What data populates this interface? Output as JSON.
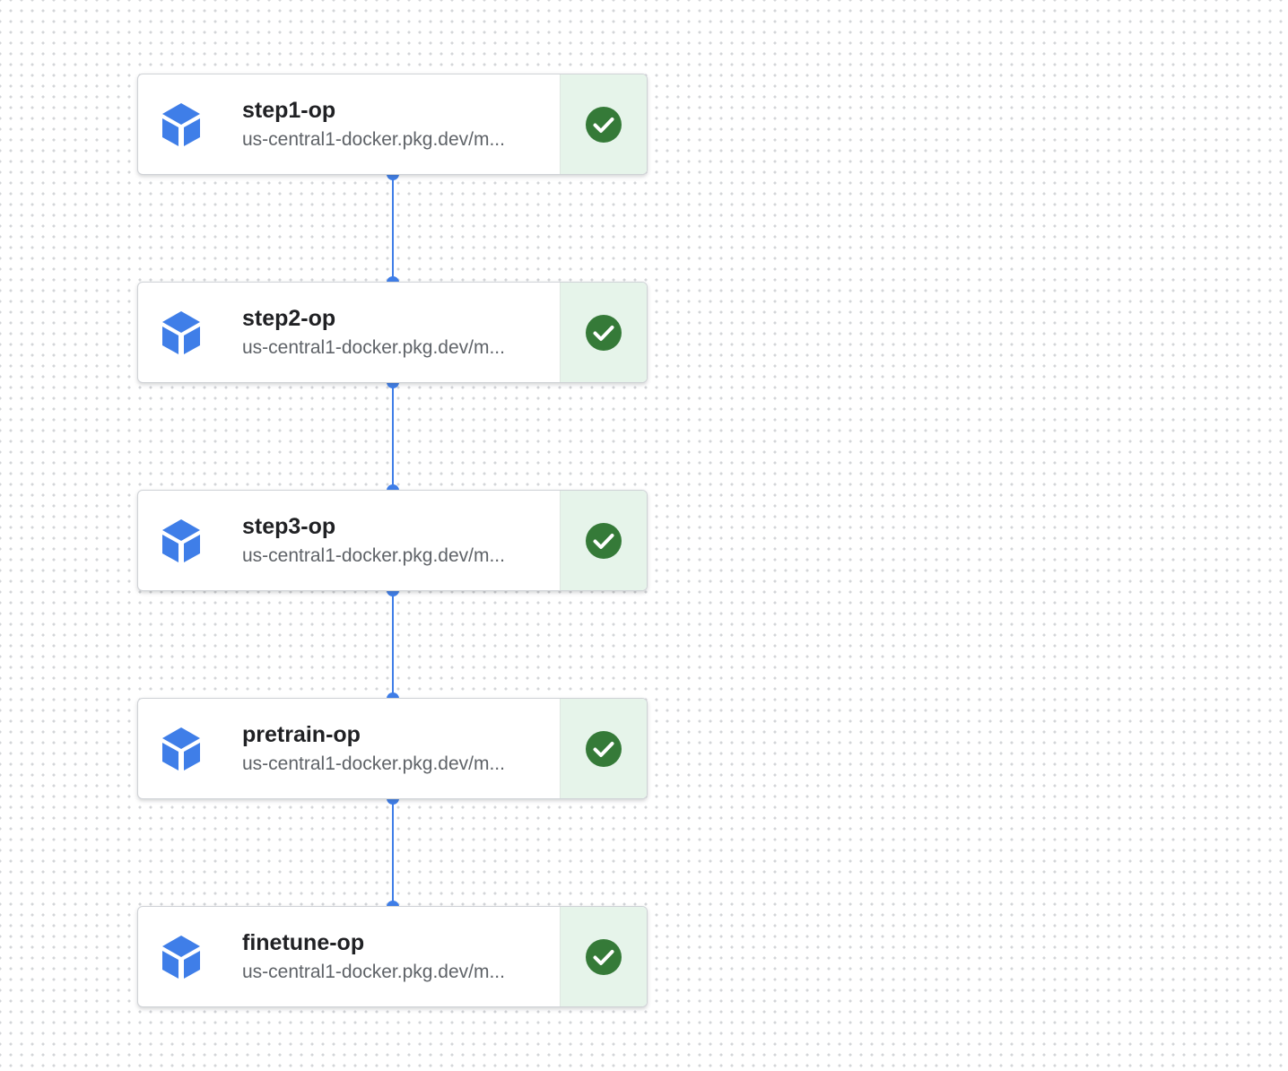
{
  "pipeline": {
    "accent_color": "#3f7ee8",
    "status_success_color": "#357a38",
    "status_success_bg": "#e6f4ea",
    "nodes": [
      {
        "name": "step1-op",
        "image": "us-central1-docker.pkg.dev/m...",
        "status": "succeeded",
        "icon": "container-cube-icon",
        "status_icon": "check-circle-icon"
      },
      {
        "name": "step2-op",
        "image": "us-central1-docker.pkg.dev/m...",
        "status": "succeeded",
        "icon": "container-cube-icon",
        "status_icon": "check-circle-icon"
      },
      {
        "name": "step3-op",
        "image": "us-central1-docker.pkg.dev/m...",
        "status": "succeeded",
        "icon": "container-cube-icon",
        "status_icon": "check-circle-icon"
      },
      {
        "name": "pretrain-op",
        "image": "us-central1-docker.pkg.dev/m...",
        "status": "succeeded",
        "icon": "container-cube-icon",
        "status_icon": "check-circle-icon"
      },
      {
        "name": "finetune-op",
        "image": "us-central1-docker.pkg.dev/m...",
        "status": "succeeded",
        "icon": "container-cube-icon",
        "status_icon": "check-circle-icon"
      }
    ],
    "edges": [
      {
        "from": "step1-op",
        "to": "step2-op"
      },
      {
        "from": "step2-op",
        "to": "step3-op"
      },
      {
        "from": "step3-op",
        "to": "pretrain-op"
      },
      {
        "from": "pretrain-op",
        "to": "finetune-op"
      }
    ]
  }
}
